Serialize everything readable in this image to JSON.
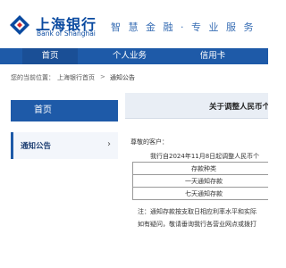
{
  "header": {
    "bank_name_cn": "上海银行",
    "bank_name_en": "Bank of Shanghai",
    "slogan": "智 慧 金 融 · 专 业 服 务",
    "brand_color": "#0a4aa0"
  },
  "nav": {
    "items": [
      {
        "label": "首页"
      },
      {
        "label": "个人业务"
      },
      {
        "label": "信用卡"
      }
    ],
    "bg_color": "#1e5aa8"
  },
  "breadcrumb": {
    "prefix": "您的当前位置：",
    "items": [
      "上海银行首页",
      "通知公告"
    ],
    "separator": ">"
  },
  "sidebar": {
    "header": "首页",
    "items": [
      {
        "label": "通知公告",
        "icon": "chevron-right-icon",
        "icon_glyph": "›"
      }
    ]
  },
  "article": {
    "title": "关于调整人民币个",
    "greeting": "尊敬的客户：",
    "body": "我行自2024年11月8日起调整人民币个",
    "table_rows": [
      "存款种类",
      "一天通知存款",
      "七天通知存款"
    ],
    "note_1": "注：通知存款按支取日相应利率水平和实际",
    "note_2": "如有疑问，敬请垂询我行各营业网点或拨打"
  }
}
